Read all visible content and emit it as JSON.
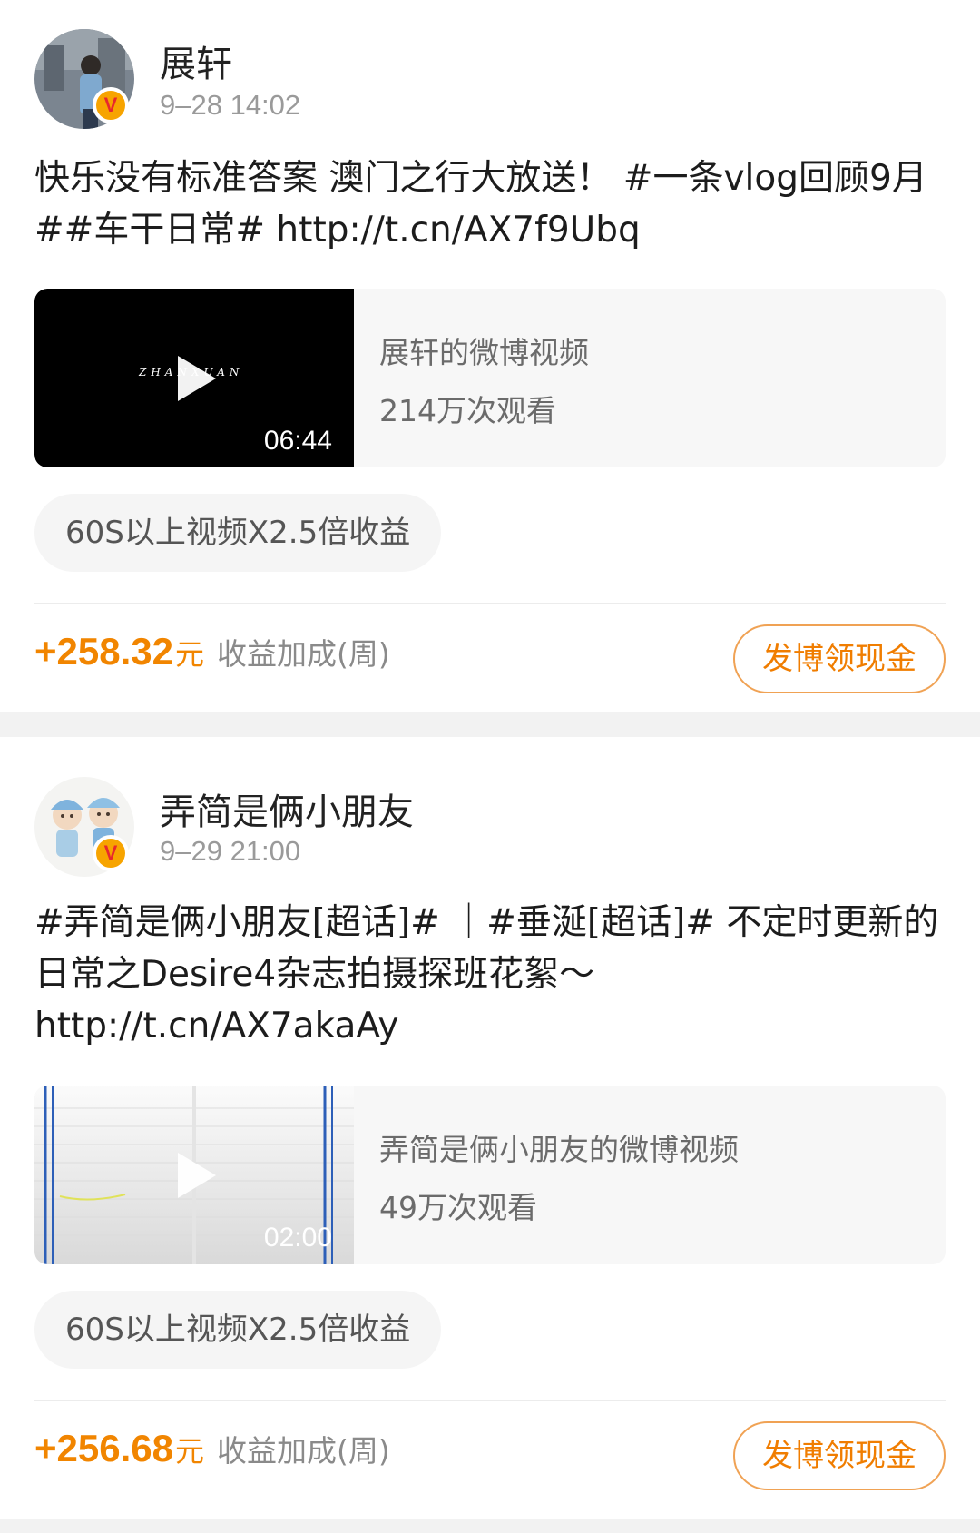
{
  "posts": [
    {
      "username": "展轩",
      "time": "9–28 14:02",
      "text": "快乐没有标准答案 澳门之行大放送！ #一条vlog回顾9月##车干日常# http://t.cn/AX7f9Ubq",
      "video": {
        "thumb_text": "ZHANXUAN",
        "duration": "06:44",
        "title": "展轩的微博视频",
        "views": "214万次观看"
      },
      "promo_tag": "60S以上视频X2.5倍收益",
      "earnings": {
        "amount": "+258.32",
        "unit": "元",
        "label": "收益加成(周)"
      },
      "cta": "发博领现金"
    },
    {
      "username": "弄简是俩小朋友",
      "time": "9–29 21:00",
      "text": "#弄简是俩小朋友[超话]# ｜#垂涎[超话]# 不定时更新的日常之Desire4杂志拍摄探班花絮～ http://t.cn/AX7akaAy",
      "video": {
        "duration": "02:00",
        "title": "弄简是俩小朋友的微博视频",
        "views": "49万次观看"
      },
      "promo_tag": "60S以上视频X2.5倍收益",
      "earnings": {
        "amount": "+256.68",
        "unit": "元",
        "label": "收益加成(周)"
      },
      "cta": "发博领现金"
    }
  ],
  "badge": {
    "letter": "V",
    "color": "#f7a400",
    "letter_color": "#e8272d"
  },
  "colors": {
    "accent": "#f18500",
    "button_border": "#f0a254",
    "secondary_text": "#9a9a9a"
  },
  "icons": {
    "play": "play-icon",
    "verified": "verified-badge-icon"
  }
}
